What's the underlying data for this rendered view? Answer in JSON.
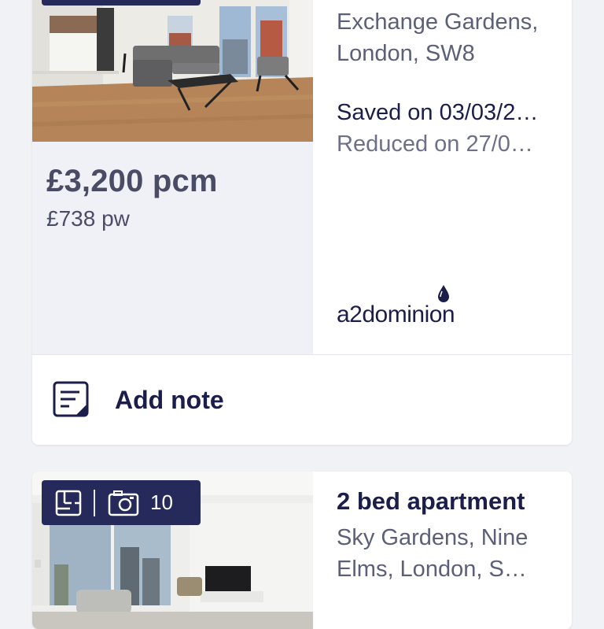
{
  "listings": [
    {
      "photo_count": "",
      "address": "Exchange Gardens, London, SW8",
      "price": "£3,200 pcm",
      "price_weekly": "£738 pw",
      "saved_text": "Saved on 03/03/2…",
      "reduced_text": "Reduced on 27/0…",
      "agent_name": "a2dominion",
      "note_label": "Add note"
    },
    {
      "title": "2 bed apartment",
      "photo_count": "10",
      "address": "Sky Gardens, Nine Elms, London, S…"
    }
  ],
  "colors": {
    "navy": "#1b1d4a",
    "badge": "#262a5a",
    "muted_text": "#5c5f78",
    "background": "#f1f2f5"
  },
  "icons": {
    "floorplan": "floorplan-icon",
    "camera": "camera-icon",
    "note": "note-icon",
    "agent_drop": "water-drop-logo-icon"
  }
}
